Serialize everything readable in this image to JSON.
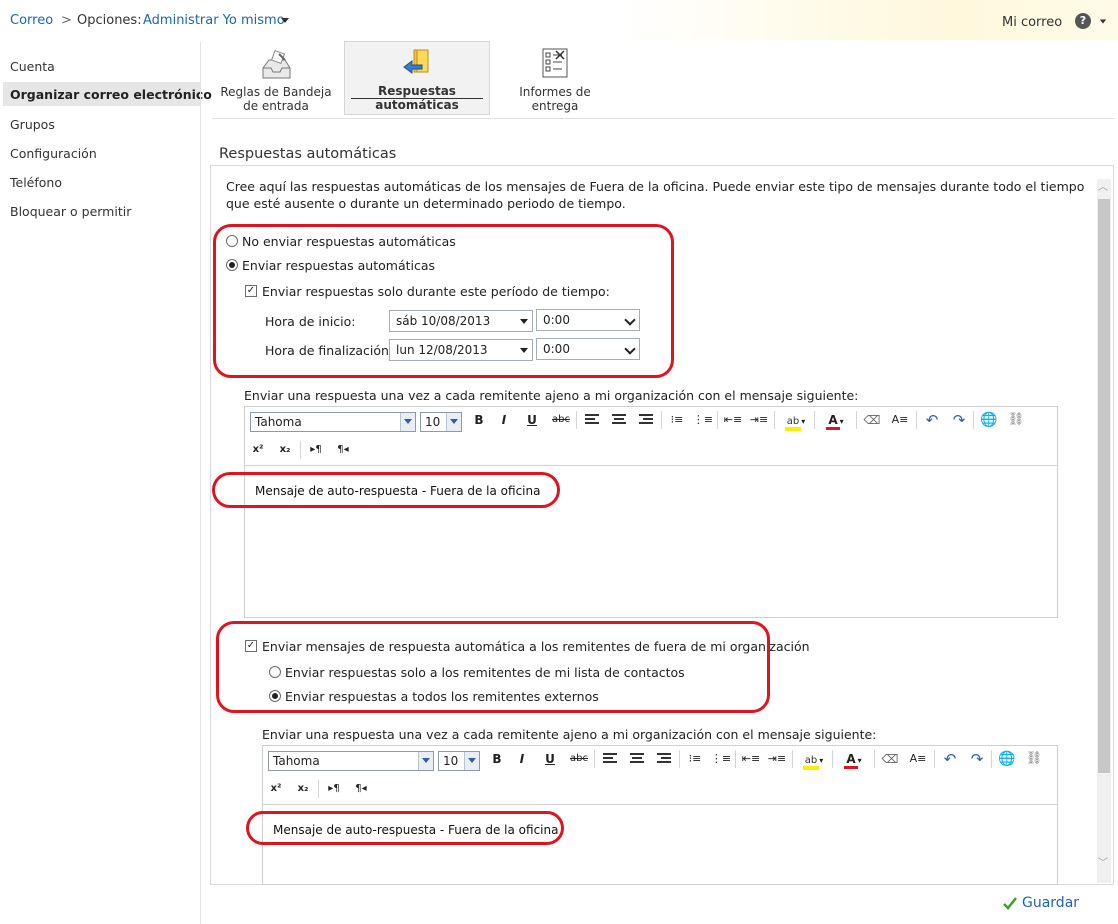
{
  "breadcrumb": {
    "root": "Correo",
    "sep": ">",
    "options": "Opciones:",
    "current": "Administrar Yo mismo"
  },
  "header": {
    "my_mail": "Mi correo",
    "help": "?"
  },
  "sidebar": {
    "items": [
      {
        "label": "Cuenta"
      },
      {
        "label": "Organizar correo electrónico"
      },
      {
        "label": "Grupos"
      },
      {
        "label": "Configuración"
      },
      {
        "label": "Teléfono"
      },
      {
        "label": "Bloquear o permitir"
      }
    ]
  },
  "ribbon": {
    "rules": "Reglas de Bandeja de entrada",
    "auto": "Respuestas automáticas",
    "reports": "Informes de entrega"
  },
  "section": {
    "title": "Respuestas automáticas",
    "description": "Cree aquí las respuestas automáticas de los mensajes de Fuera de la oficina. Puede enviar este tipo de mensajes durante todo el tiempo que esté ausente o durante un determinado periodo de tiempo."
  },
  "options": {
    "no_send": "No enviar respuestas automáticas",
    "send": "Enviar respuestas automáticas",
    "period": "Enviar respuestas solo durante este período de tiempo:",
    "start_label": "Hora de inicio:",
    "start_date": "sáb 10/08/2013",
    "start_time": "0:00",
    "end_label": "Hora de finalización:",
    "end_date": "lun 12/08/2013",
    "end_time": "0:00"
  },
  "internal": {
    "caption": "Enviar una respuesta una vez a cada remitente ajeno a mi organización con el mensaje siguiente:",
    "font": "Tahoma",
    "size": "10",
    "message": "Mensaje de auto-respuesta - Fuera de la oficina"
  },
  "external": {
    "checkbox": "Enviar mensajes de respuesta automática a los remitentes de fuera de mi organización",
    "contacts_only": "Enviar respuestas solo a los remitentes de mi lista de contactos",
    "all_external": "Enviar respuestas a todos los remitentes externos",
    "caption": "Enviar una respuesta una vez a cada remitente ajeno a mi organización con el mensaje siguiente:",
    "font": "Tahoma",
    "size": "10",
    "message": "Mensaje de auto-respuesta - Fuera de la oficina"
  },
  "toolbar": {
    "bold": "B",
    "italic": "I",
    "underline": "U",
    "strike": "abc",
    "superscript": "x²",
    "subscript": "x₂"
  },
  "footer": {
    "save": "Guardar"
  },
  "colors": {
    "link": "#1e65b0",
    "highlight_red": "#e0141e",
    "save_check": "#3aa02a"
  }
}
